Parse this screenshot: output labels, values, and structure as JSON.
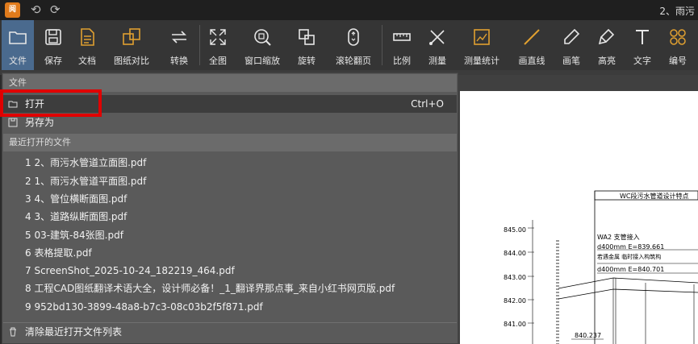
{
  "app": {
    "logo_text": "阅",
    "title": "2、雨污"
  },
  "toolbar": {
    "items": [
      {
        "label": "文件",
        "icon": "folder-icon"
      },
      {
        "label": "保存",
        "icon": "save-icon"
      },
      {
        "label": "文档",
        "icon": "document-icon"
      },
      {
        "label": "图纸对比",
        "icon": "compare-icon"
      },
      {
        "label": "转换",
        "icon": "convert-icon"
      },
      {
        "label": "全图",
        "icon": "fullscreen-icon"
      },
      {
        "label": "窗口缩放",
        "icon": "zoom-window-icon"
      },
      {
        "label": "旋转",
        "icon": "rotate-icon"
      },
      {
        "label": "滚轮翻页",
        "icon": "mouse-wheel-icon"
      },
      {
        "label": "比例",
        "icon": "ruler-icon"
      },
      {
        "label": "测量",
        "icon": "measure-icon"
      },
      {
        "label": "测量统计",
        "icon": "measure-stats-icon"
      },
      {
        "label": "画直线",
        "icon": "line-icon"
      },
      {
        "label": "画笔",
        "icon": "pen-icon"
      },
      {
        "label": "高亮",
        "icon": "highlight-icon"
      },
      {
        "label": "文字",
        "icon": "text-icon"
      },
      {
        "label": "编号",
        "icon": "numbering-icon"
      }
    ],
    "colors": {
      "active_bg": "#4a6a8e",
      "accent": "#e0a030"
    }
  },
  "menu": {
    "file_header": "文件",
    "open_label": "打开",
    "open_shortcut": "Ctrl+O",
    "saveas_label": "另存为",
    "recent_header": "最近打开的文件",
    "recent_files": [
      "1 2、雨污水管道立面图.pdf",
      "2 1、雨污水管道平面图.pdf",
      "3 4、管位横断面图.pdf",
      "4 3、道路纵断面图.pdf",
      "5 03-建筑-84张图.pdf",
      "6 表格提取.pdf",
      "7 ScreenShot_2025-10-24_182219_464.pdf",
      "8 工程CAD图纸翻译术语大全，设计师必备！_1_翻译界那点事_来自小红书网页版.pdf",
      "9 952bd130-3899-48a8-b7c3-08c03b2f5f871.pdf"
    ],
    "clear_label": "清除最近打开文件列表"
  },
  "drawing": {
    "heading": "WC段污水管道设计特点",
    "item_a": "WA2 支管接入",
    "spec_1": "d400mm E=839.661",
    "note_1": "若遇金属 临时接入构筑构",
    "spec_2": "d400mm E=840.701",
    "elevations": [
      "845.00",
      "844.00",
      "843.00",
      "842.00",
      "841.00"
    ],
    "point_label": "840.237"
  }
}
